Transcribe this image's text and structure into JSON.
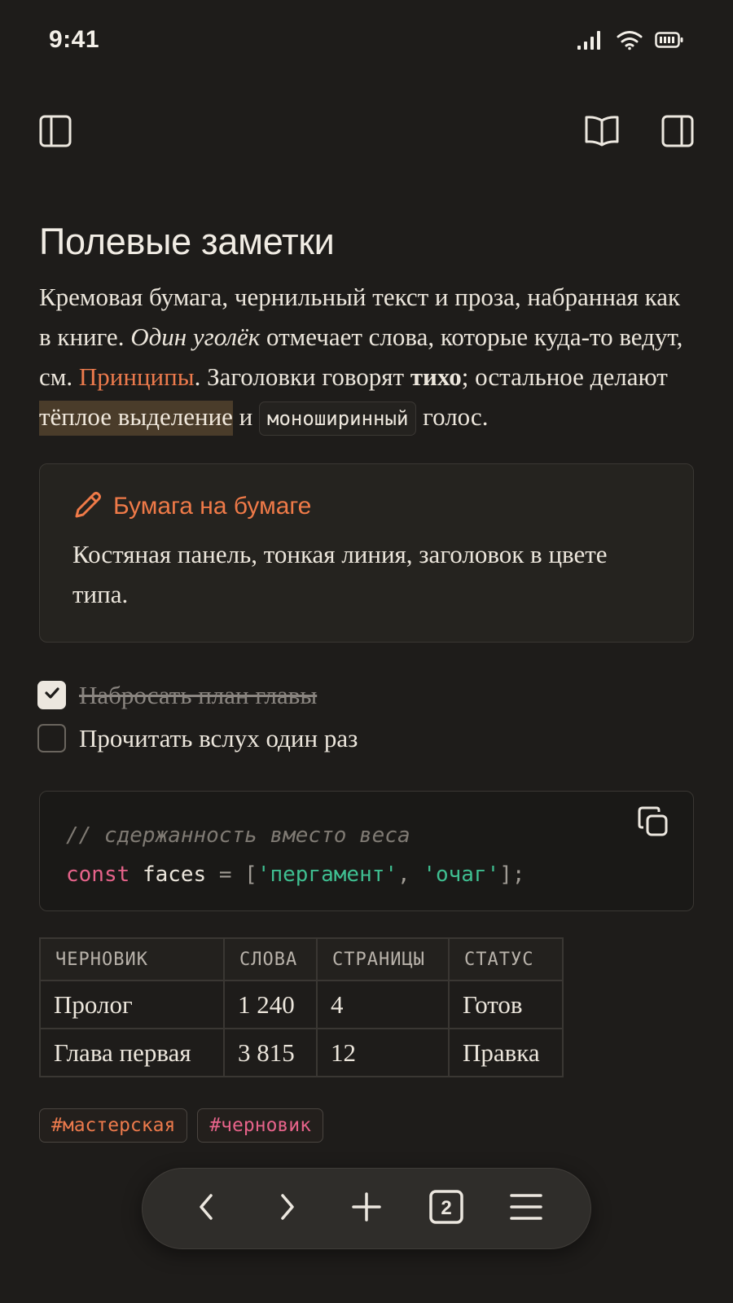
{
  "status_bar": {
    "time": "9:41"
  },
  "toolbar": {
    "left_icon": "sidebar-left-icon",
    "right_icons": [
      "book-icon",
      "sidebar-right-icon"
    ]
  },
  "note": {
    "title": "Полевые заметки",
    "paragraph": {
      "t1": "Кремовая бумага, чернильный текст и проза, набранная как в книге. ",
      "em": "Один уголёк",
      "t2": " отмечает слова, которые куда-то ведут, см. ",
      "link": "Принципы",
      "t3": ". Заголовки говорят ",
      "strong": "тихо",
      "t4": "; остальное делают ",
      "highlight": "тёплое выделение",
      "t5": " и ",
      "code": "моноширинный",
      "t6": " голос."
    },
    "callout": {
      "icon": "pencil-icon",
      "title": "Бумага на бумаге",
      "body": "Костяная панель, тонкая линия, заголовок в цвете типа."
    },
    "tasks": [
      {
        "label": "Набросать план главы",
        "checked": true
      },
      {
        "label": "Прочитать вслух один раз",
        "checked": false
      }
    ],
    "code_block": {
      "comment": "// сдержанность вместо веса",
      "keyword": "const",
      "identifier": "faces",
      "op": " = [",
      "str1": "'пергамент'",
      "sep": ", ",
      "str2": "'очаг'",
      "end": "];"
    },
    "table": {
      "headers": [
        "ЧЕРНОВИК",
        "СЛОВА",
        "СТРАНИЦЫ",
        "СТАТУС"
      ],
      "rows": [
        [
          "Пролог",
          "1 240",
          "4",
          "Готов"
        ],
        [
          "Глава первая",
          "3 815",
          "12",
          "Правка"
        ]
      ]
    },
    "tags": [
      "#мастерская",
      "#черновик"
    ]
  },
  "bottom_nav": {
    "tab_count": "2",
    "icons": [
      "back-icon",
      "forward-icon",
      "plus-icon",
      "tabs-icon",
      "menu-icon"
    ]
  },
  "colors": {
    "background": "#1e1c1a",
    "accent": "#ec7a4c",
    "highlight": "#4a3c2a",
    "string": "#3fbf91",
    "keyword": "#e6638a"
  }
}
